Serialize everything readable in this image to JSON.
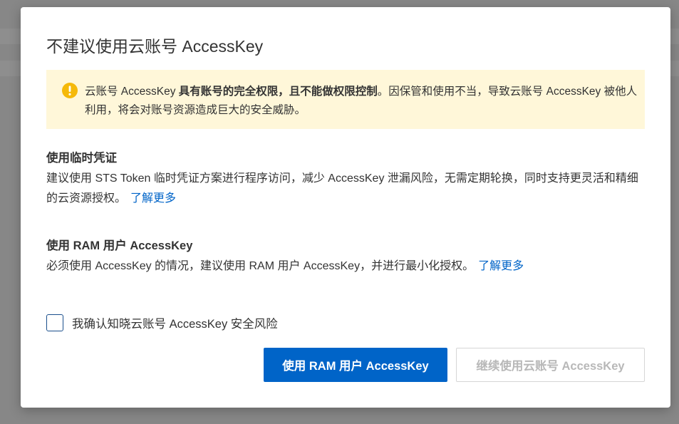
{
  "dialog": {
    "title": "不建议使用云账号 AccessKey"
  },
  "alert": {
    "icon": "warning-circle-icon",
    "icon_color": "#f5b90a",
    "background": "#fff7d9",
    "text_prefix": "云账号 AccessKey ",
    "text_bold": "具有账号的完全权限，且不能做权限控制",
    "text_suffix": "。因保管和使用不当，导致云账号 AccessKey 被他人利用，将会对账号资源造成巨大的安全威胁。"
  },
  "sections": [
    {
      "title": "使用临时凭证",
      "body": "建议使用 STS Token 临时凭证方案进行程序访问，减少 AccessKey 泄漏风险，无需定期轮换，同时支持更灵活和精细的云资源授权。",
      "link": "了解更多"
    },
    {
      "title": "使用 RAM 用户 AccessKey",
      "body": "必须使用 AccessKey 的情况，建议使用 RAM 用户 AccessKey，并进行最小化授权。",
      "link": "了解更多"
    }
  ],
  "confirm": {
    "checked": false,
    "label": "我确认知晓云账号 AccessKey 安全风险"
  },
  "buttons": {
    "primary": "使用 RAM 用户 AccessKey",
    "secondary": "继续使用云账号 AccessKey",
    "secondary_disabled": true
  },
  "colors": {
    "accent": "#0064c8",
    "link": "#0064c8",
    "warning": "#f5b90a"
  }
}
